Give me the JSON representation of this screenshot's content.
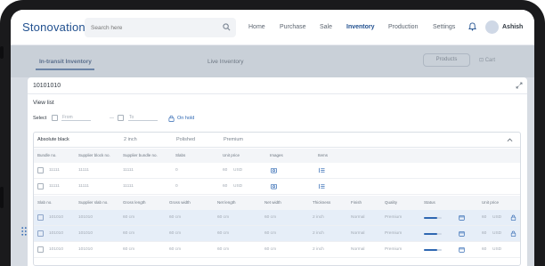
{
  "colors": {
    "brand": "#21508f",
    "accent": "#2e67b2",
    "frame": "#1a1a1c"
  },
  "app": {
    "logo": "Stonovation"
  },
  "search": {
    "placeholder": "Search here"
  },
  "nav": {
    "items": [
      "Home",
      "Purchase",
      "Sale",
      "Inventory",
      "Production",
      "Settings"
    ],
    "active": "Inventory"
  },
  "user": {
    "name": "Ashish"
  },
  "subnav": {
    "tabs": [
      "In-transit Inventory",
      "Live Inventory"
    ],
    "button": "Products",
    "cart": "Cart"
  },
  "modal": {
    "title": "10101010",
    "view_label": "View list",
    "select_label": "Select",
    "from_placeholder": "From",
    "to_placeholder": "To",
    "range_separator": "—",
    "on_hold_label": "On hold"
  },
  "group": {
    "name": "Absolute black",
    "thickness": "2 inch",
    "finish": "Polished",
    "quality": "Premium"
  },
  "bundle_table": {
    "headers": [
      "Bundle no.",
      "Supplier block no.",
      "Supplier bundle no.",
      "Slabs",
      "Unit price",
      "Images",
      "Items"
    ],
    "rows": [
      {
        "bundle": "11111",
        "block": "11111",
        "supplier_bundle": "11111",
        "slabs": "0",
        "price": "60",
        "currency": "USD"
      },
      {
        "bundle": "11111",
        "block": "11111",
        "supplier_bundle": "11111",
        "slabs": "0",
        "price": "60",
        "currency": "USD"
      }
    ]
  },
  "slab_table": {
    "headers": [
      "Slab no.",
      "Supplier slab no.",
      "Gross length",
      "Gross width",
      "Net length",
      "Net width",
      "Thickness",
      "Finish",
      "Quality",
      "Status",
      "Unit price"
    ],
    "rows": [
      {
        "slab": "101010",
        "supplier": "101010",
        "gl": "60 cm",
        "gw": "60 cm",
        "nl": "60 cm",
        "nw": "60 cm",
        "th": "2 inch",
        "finish": "Normal",
        "quality": "Premium",
        "status": 0.75,
        "price": "60",
        "currency": "USD",
        "checked": true,
        "locked": true
      },
      {
        "slab": "101010",
        "supplier": "101010",
        "gl": "60 cm",
        "gw": "60 cm",
        "nl": "60 cm",
        "nw": "60 cm",
        "th": "2 inch",
        "finish": "Normal",
        "quality": "Premium",
        "status": 0.75,
        "price": "60",
        "currency": "USD",
        "checked": true,
        "locked": true
      },
      {
        "slab": "101010",
        "supplier": "101010",
        "gl": "60 cm",
        "gw": "60 cm",
        "nl": "60 cm",
        "nw": "60 cm",
        "th": "2 inch",
        "finish": "Normal",
        "quality": "Premium",
        "status": 0.75,
        "price": "60",
        "currency": "USD",
        "checked": false,
        "locked": false
      }
    ]
  }
}
